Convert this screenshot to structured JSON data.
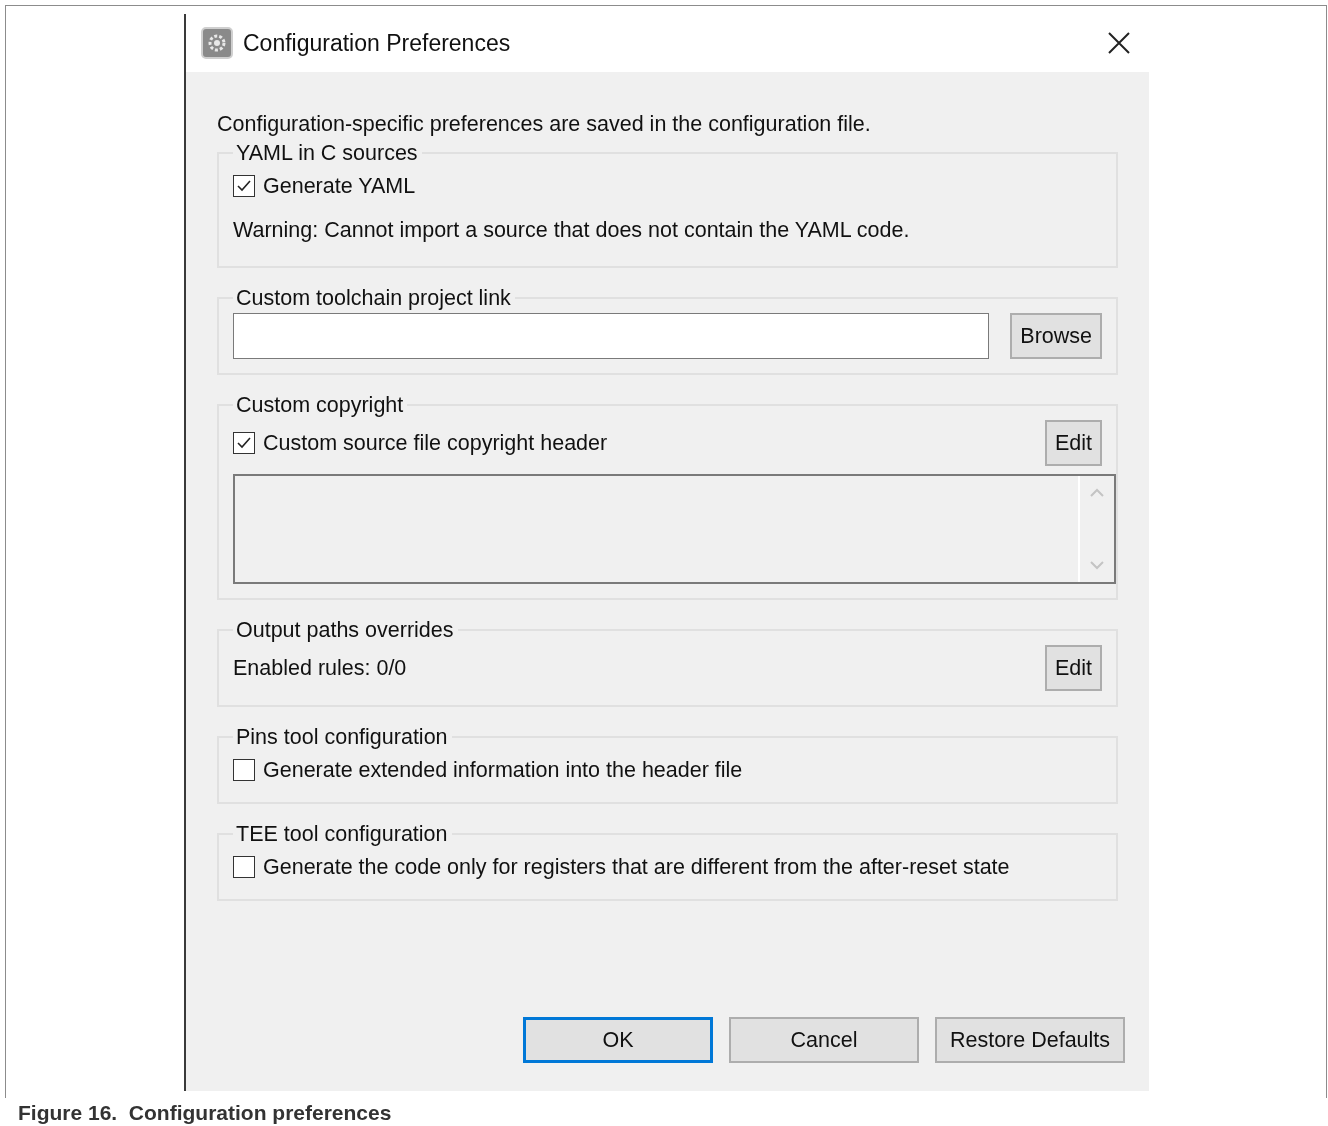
{
  "window": {
    "title": "Configuration Preferences"
  },
  "intro": "Configuration-specific preferences are saved in the configuration file.",
  "groups": [
    {
      "title": "YAML in C sources",
      "rows": [
        {
          "kind": "checkbox",
          "label": "Generate YAML",
          "checked": true
        },
        {
          "kind": "text",
          "text": "Warning: Cannot import a source that does not contain the YAML code."
        }
      ]
    },
    {
      "title": "Custom toolchain project link",
      "rows": [
        {
          "kind": "path",
          "button": "Browse"
        }
      ]
    },
    {
      "title": "Custom copyright",
      "rows": [
        {
          "kind": "checkbox",
          "label": "Custom source file copyright header",
          "checked": true,
          "button": "Edit"
        },
        {
          "kind": "textarea"
        }
      ]
    },
    {
      "title": "Output paths overrides",
      "rows": [
        {
          "kind": "text",
          "text": "Enabled rules: 0/0",
          "button": "Edit"
        }
      ]
    },
    {
      "title": "Pins tool configuration",
      "rows": [
        {
          "kind": "checkbox",
          "label": "Generate extended information into the header file",
          "checked": false
        }
      ]
    },
    {
      "title": "TEE tool configuration",
      "rows": [
        {
          "kind": "checkbox",
          "label": "Generate the code only for registers that are different from the after-reset state",
          "checked": false
        }
      ]
    }
  ],
  "buttons": [
    {
      "label": "OK",
      "default": true
    },
    {
      "label": "Cancel",
      "default": false
    },
    {
      "label": "Restore Defaults",
      "default": false
    }
  ],
  "caption": "Figure 16.  Configuration preferences"
}
